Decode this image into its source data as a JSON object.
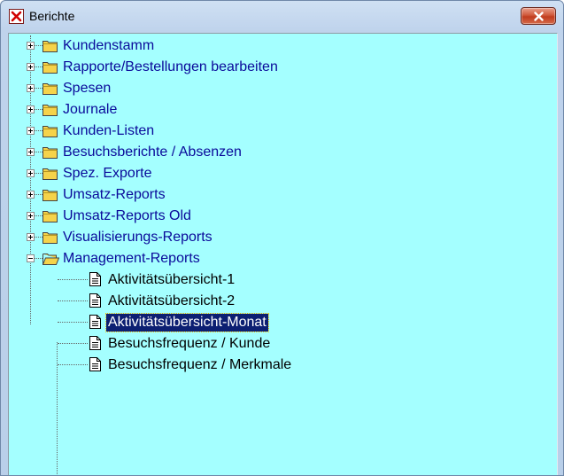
{
  "window": {
    "title": "Berichte"
  },
  "colors": {
    "tree_background": "#a4ffff",
    "folder_label": "#0a0a9a",
    "selection": "#0c1f72",
    "folder_fill": "#f5d34a"
  },
  "tree": {
    "folders": [
      {
        "label": "Kundenstamm",
        "state": "collapsed"
      },
      {
        "label": "Rapporte/Bestellungen bearbeiten",
        "state": "collapsed"
      },
      {
        "label": "Spesen",
        "state": "collapsed"
      },
      {
        "label": "Journale",
        "state": "collapsed"
      },
      {
        "label": "Kunden-Listen",
        "state": "collapsed"
      },
      {
        "label": "Besuchsberichte / Absenzen",
        "state": "collapsed"
      },
      {
        "label": "Spez. Exporte",
        "state": "collapsed"
      },
      {
        "label": "Umsatz-Reports",
        "state": "collapsed"
      },
      {
        "label": "Umsatz-Reports Old",
        "state": "collapsed"
      },
      {
        "label": "Visualisierungs-Reports",
        "state": "collapsed"
      },
      {
        "label": "Management-Reports",
        "state": "expanded"
      }
    ],
    "reports": [
      {
        "label": "Aktivitätsübersicht-1",
        "selected": false
      },
      {
        "label": "Aktivitätsübersicht-2",
        "selected": false
      },
      {
        "label": "Aktivitätsübersicht-Monat",
        "selected": true
      },
      {
        "label": "Besuchsfrequenz / Kunde",
        "selected": false
      },
      {
        "label": "Besuchsfrequenz / Merkmale",
        "selected": false
      }
    ]
  }
}
